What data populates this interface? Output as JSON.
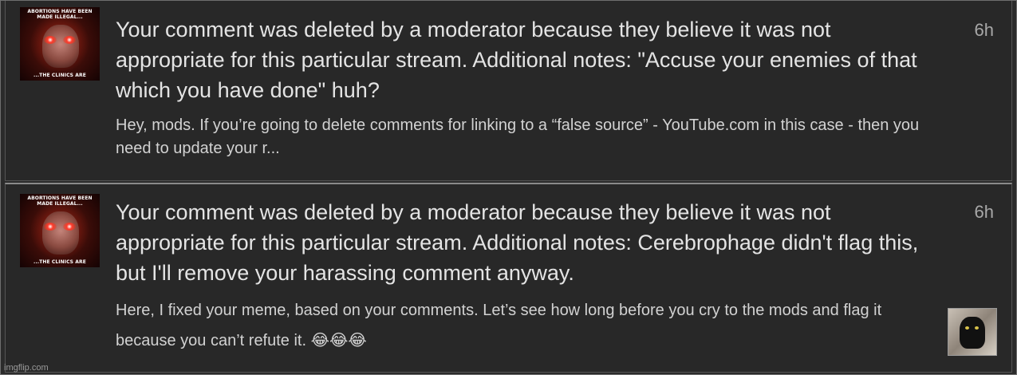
{
  "notifications": [
    {
      "avatar": {
        "icon": "meme-avatar-icon",
        "caption_top": "ABORTIONS HAVE BEEN MADE ILLEGAL...",
        "caption_bottom": "...THE CLINICS ARE"
      },
      "title": "Your comment was deleted by a moderator because they believe it was not appropriate for this particular stream. Additional notes: \"Accuse your enemies of that which you have done\" huh?",
      "time": "6h",
      "snippet": "Hey, mods. If you’re going to delete comments for linking to a “false source” - YouTube.com in this case - then you need to update your r..."
    },
    {
      "avatar": {
        "icon": "meme-avatar-icon",
        "caption_top": "ABORTIONS HAVE BEEN MADE ILLEGAL...",
        "caption_bottom": "...THE CLINICS ARE"
      },
      "title": "Your comment was deleted by a moderator because they believe it was not appropriate for this particular stream. Additional notes: Cerebrophage didn't flag this, but I'll remove your harassing comment anyway.",
      "time": "6h",
      "snippet": "Here, I fixed your meme, based on your comments. Let’s see how long before you cry to the mods and flag it because you can’t refute it.",
      "emojis": "😂😂😂",
      "thumbnail": {
        "icon": "black-cat-meme-icon"
      }
    }
  ],
  "watermark": "imgflip.com",
  "colors": {
    "background": "#2b2b2b",
    "title_text": "#e4e4e4",
    "snippet_text": "#d2d2d2",
    "time_text": "#a8a8a8",
    "divider": "#8a8a8a"
  }
}
